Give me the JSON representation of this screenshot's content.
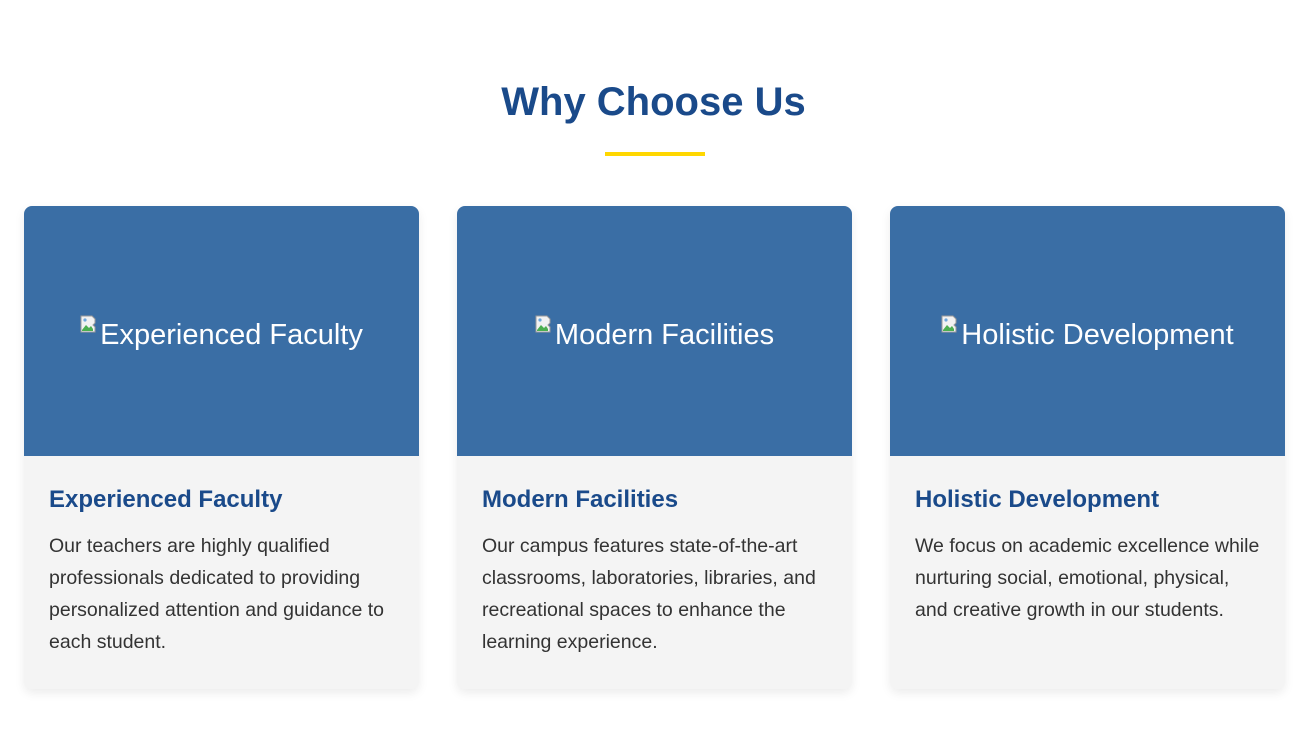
{
  "section": {
    "title": "Why Choose Us",
    "accent_color": "#ffd700",
    "title_color": "#1a4a8a",
    "image_bg_color": "#3a6ea5"
  },
  "cards": [
    {
      "image_alt": "Experienced Faculty",
      "heading": "Experienced Faculty",
      "text": "Our teachers are highly qualified professionals dedicated to providing personalized attention and guidance to each student."
    },
    {
      "image_alt": "Modern Facilities",
      "heading": "Modern Facilities",
      "text": "Our campus features state-of-the-art classrooms, laboratories, libraries, and recreational spaces to enhance the learning experience."
    },
    {
      "image_alt": "Holistic Development",
      "heading": "Holistic Development",
      "text": "We focus on academic excellence while nurturing social, emotional, physical, and creative growth in our students."
    }
  ],
  "icons": {
    "broken_image": "broken-image-icon"
  }
}
